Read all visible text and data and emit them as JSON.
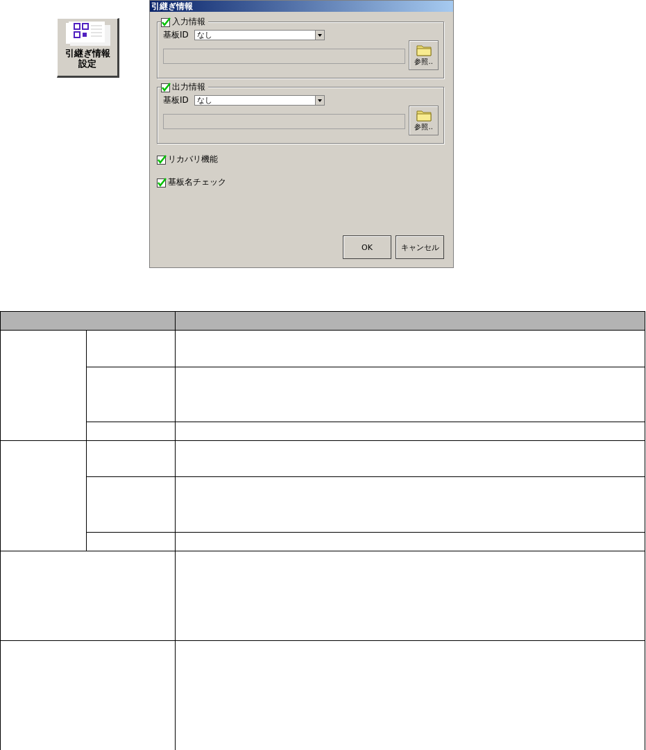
{
  "launcher": {
    "lines": [
      "引継ぎ情報",
      "設定"
    ]
  },
  "dialog": {
    "title": "引継ぎ情報",
    "groups": [
      {
        "label": "入力情報",
        "checked": true,
        "board_id_label": "基板ID",
        "board_id": "なし",
        "browse_button": "参照.."
      },
      {
        "label": "出力情報",
        "checked": true,
        "board_id_label": "基板ID",
        "board_id": "なし",
        "browse_button": "参照.."
      }
    ],
    "options": [
      {
        "label": "リカバリ機能",
        "checked": true
      },
      {
        "label": "基板名チェック",
        "checked": true
      }
    ],
    "buttons": [
      "OK",
      "キャンセル"
    ]
  }
}
